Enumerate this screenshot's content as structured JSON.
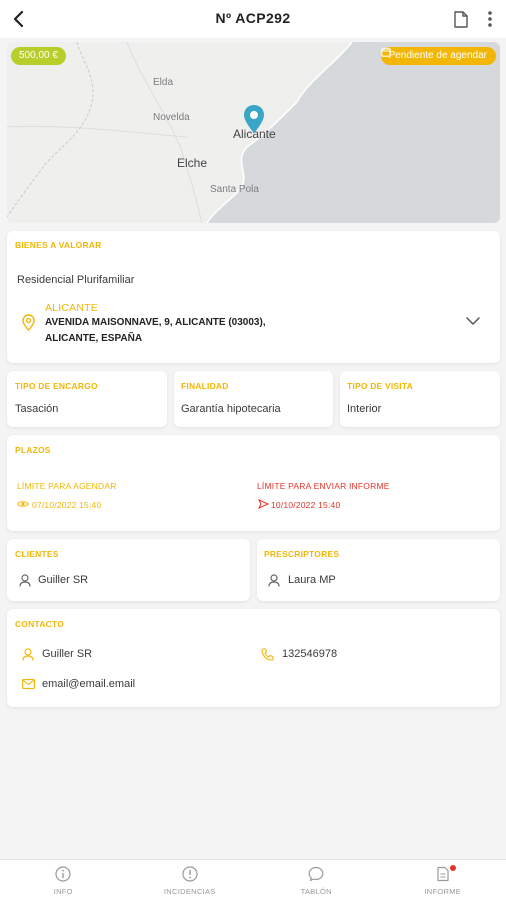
{
  "header": {
    "title": "Nº ACP292",
    "back_icon": "back-arrow-icon",
    "document_icon": "document-icon",
    "more_icon": "more-vertical-icon"
  },
  "map": {
    "price": "500,00 €",
    "status": "Pendiente de agendar",
    "places": [
      "Elda",
      "Novelda",
      "Alicante",
      "Elche",
      "Santa Pola"
    ]
  },
  "bienes": {
    "title": "BIENES A VALORAR",
    "type": "Residencial Plurifamiliar",
    "city": "ALICANTE",
    "address_line1": "AVENIDA MAISONNAVE, 9, ALICANTE (03003),",
    "address_line2": "ALICANTE, ESPAÑA"
  },
  "encargo": {
    "title": "TIPO DE ENCARGO",
    "value": "Tasación"
  },
  "finalidad": {
    "title": "FINALIDAD",
    "value": "Garantía hipotecaria"
  },
  "visita": {
    "title": "TIPO DE VISITA",
    "value": "Interior"
  },
  "plazos": {
    "title": "PLAZOS",
    "agendar_label": "LÍMITE PARA AGENDAR",
    "agendar_value": "07/10/2022 15:40",
    "informe_label": "LÍMITE PARA ENVIAR INFORME",
    "informe_value": "10/10/2022 15:40"
  },
  "clientes": {
    "title": "CLIENTES",
    "value": "Guiller SR"
  },
  "prescriptores": {
    "title": "PRESCRIPTORES",
    "value": "Laura MP"
  },
  "contacto": {
    "title": "CONTACTO",
    "name": "Guiller SR",
    "phone": "132546978",
    "email": "email@email.email"
  },
  "nav": [
    {
      "label": "INFO",
      "icon": "info-icon"
    },
    {
      "label": "INCIDENCIAS",
      "icon": "alert-icon"
    },
    {
      "label": "TABLÓN",
      "icon": "chat-icon"
    },
    {
      "label": "INFORME",
      "icon": "report-icon"
    }
  ],
  "colors": {
    "accent": "#f2b705",
    "price": "#b7cf2a",
    "danger": "#e5332a",
    "pin": "#3aa6c7"
  }
}
